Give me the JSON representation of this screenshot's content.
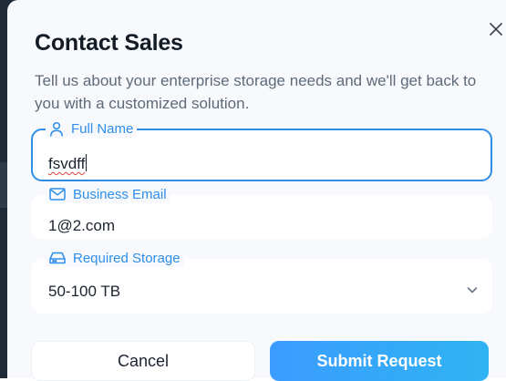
{
  "modal": {
    "title": "Contact Sales",
    "subtitle": "Tell us about your enterprise storage needs and we'll get back to you with a customized solution.",
    "close_icon": "close-icon"
  },
  "fields": {
    "full_name": {
      "label": "Full Name",
      "value": "fsvdff",
      "icon": "user-icon",
      "focused": true,
      "spellcheck_error": true
    },
    "business_email": {
      "label": "Business Email",
      "value": "1@2.com",
      "icon": "mail-icon"
    },
    "required_storage": {
      "label": "Required Storage",
      "value": "50-100 TB",
      "icon": "hard-drive-icon"
    }
  },
  "actions": {
    "cancel_label": "Cancel",
    "submit_label": "Submit Request"
  },
  "colors": {
    "accent": "#2f8ee8",
    "title": "#131b26",
    "subtitle": "#5f6b7a",
    "spell_error": "#e0403a"
  }
}
